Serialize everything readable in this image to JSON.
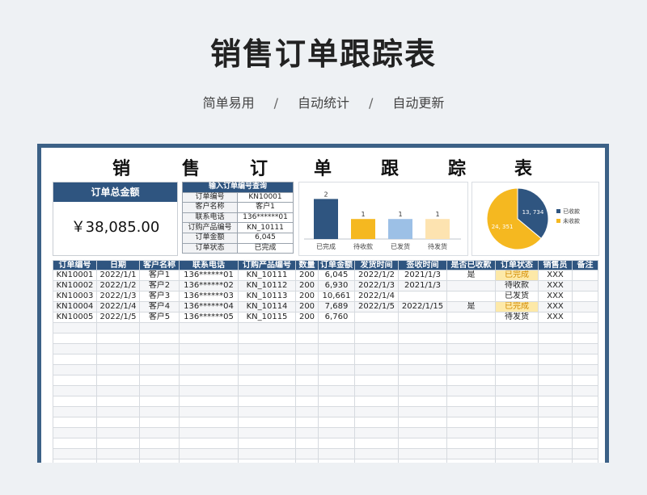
{
  "header": {
    "title": "销售订单跟踪表",
    "features": [
      "简单易用",
      "自动统计",
      "自动更新"
    ],
    "separator": "/"
  },
  "sheet": {
    "title_chars": [
      "销",
      "售",
      "订",
      "单",
      "跟",
      "踪",
      "表"
    ]
  },
  "total": {
    "label": "订单总金额",
    "value": "￥38,085.00"
  },
  "query": {
    "title": "输入订单编号查询",
    "rows": [
      {
        "label": "订单编号",
        "value": "KN10001"
      },
      {
        "label": "客户名称",
        "value": "客户1"
      },
      {
        "label": "联系电话",
        "value": "136******01"
      },
      {
        "label": "订购产品编号",
        "value": "KN_10111"
      },
      {
        "label": "订单金额",
        "value": "6,045"
      },
      {
        "label": "订单状态",
        "value": "已完成"
      }
    ]
  },
  "chart_data": [
    {
      "type": "bar",
      "categories": [
        "已完成",
        "待收款",
        "已发货",
        "待发货"
      ],
      "values": [
        2,
        1,
        1,
        1
      ],
      "ylim": [
        0,
        2.5
      ],
      "colors": [
        "#2f5580",
        "#f5b820",
        "#9cc0e6",
        "#fde3b0"
      ]
    },
    {
      "type": "pie",
      "categories": [
        "已收款",
        "未收款"
      ],
      "values": [
        13734,
        24351
      ],
      "labels": [
        "13, 734",
        "24, 351"
      ],
      "colors": [
        "#2f5580",
        "#f5b820"
      ],
      "legend": "right"
    }
  ],
  "table": {
    "columns": [
      "订单编号",
      "日期",
      "客户名称",
      "联系电话",
      "订购产品编号",
      "数量",
      "订单金额",
      "发货时间",
      "签收时间",
      "是否已收款",
      "订单状态",
      "销售员",
      "备注"
    ],
    "rows": [
      [
        "KN10001",
        "2022/1/1",
        "客户1",
        "136******01",
        "KN_10111",
        "200",
        "6,045",
        "2022/1/2",
        "2021/1/3",
        "是",
        "已完成",
        "XXX",
        ""
      ],
      [
        "KN10002",
        "2022/1/2",
        "客户2",
        "136******02",
        "KN_10112",
        "200",
        "6,930",
        "2022/1/3",
        "2021/1/3",
        "",
        "待收款",
        "XXX",
        ""
      ],
      [
        "KN10003",
        "2022/1/3",
        "客户3",
        "136******03",
        "KN_10113",
        "200",
        "10,661",
        "2022/1/4",
        "",
        "",
        "已发货",
        "XXX",
        ""
      ],
      [
        "KN10004",
        "2022/1/4",
        "客户4",
        "136******04",
        "KN_10114",
        "200",
        "7,689",
        "2022/1/5",
        "2022/1/15",
        "是",
        "已完成",
        "XXX",
        ""
      ],
      [
        "KN10005",
        "2022/1/5",
        "客户5",
        "136******05",
        "KN_10115",
        "200",
        "6,760",
        "",
        "",
        "",
        "待发货",
        "XXX",
        ""
      ]
    ],
    "status_highlight": "已完成",
    "empty_rows": 17
  }
}
